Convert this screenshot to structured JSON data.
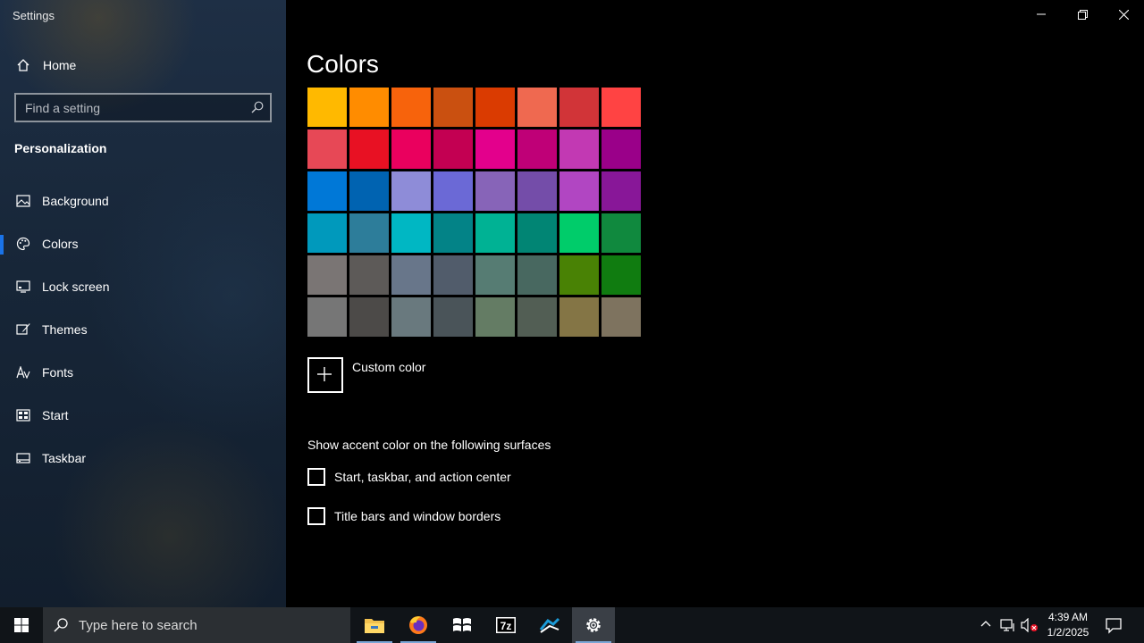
{
  "window": {
    "title": "Settings"
  },
  "sidebar": {
    "home_label": "Home",
    "search_placeholder": "Find a setting",
    "section_title": "Personalization",
    "items": [
      {
        "label": "Background",
        "icon": "picture-icon"
      },
      {
        "label": "Colors",
        "icon": "palette-icon",
        "active": true
      },
      {
        "label": "Lock screen",
        "icon": "lock-screen-icon"
      },
      {
        "label": "Themes",
        "icon": "brush-icon"
      },
      {
        "label": "Fonts",
        "icon": "font-icon"
      },
      {
        "label": "Start",
        "icon": "start-grid-icon"
      },
      {
        "label": "Taskbar",
        "icon": "taskbar-icon"
      }
    ]
  },
  "main": {
    "title": "Colors",
    "swatches": [
      "#FFB900",
      "#FF8C00",
      "#F7630C",
      "#CA5010",
      "#DA3B01",
      "#EF6950",
      "#D13438",
      "#FF4343",
      "#E74856",
      "#E81123",
      "#EA005E",
      "#C30052",
      "#E3008C",
      "#BF0077",
      "#C239B3",
      "#9A0089",
      "#0078D7",
      "#0063B1",
      "#8E8CD8",
      "#6B69D6",
      "#8764B8",
      "#744DA9",
      "#B146C2",
      "#881798",
      "#0099BC",
      "#2D7D9A",
      "#00B7C3",
      "#038387",
      "#00B294",
      "#018574",
      "#00CC6A",
      "#10893E",
      "#7A7574",
      "#5D5A58",
      "#68768A",
      "#515C6B",
      "#567C73",
      "#486860",
      "#498205",
      "#107C10",
      "#767676",
      "#4C4A48",
      "#69797E",
      "#4A5459",
      "#647C64",
      "#525E54",
      "#847545",
      "#7E735F"
    ],
    "custom_color_label": "Custom color",
    "surfaces_label": "Show accent color on the following surfaces",
    "checkboxes": [
      {
        "label": "Start, taskbar, and action center",
        "checked": false
      },
      {
        "label": "Title bars and window borders",
        "checked": false
      }
    ]
  },
  "taskbar": {
    "search_placeholder": "Type here to search",
    "apps": [
      "file-explorer-icon",
      "firefox-icon",
      "windows-7-icon",
      "7zip-icon",
      "steam-icon",
      "settings-gear-icon"
    ],
    "clock_time": "4:39 AM",
    "clock_date": "1/2/2025",
    "zip_glyph": "7z"
  },
  "colors": {
    "accent": "#1A73E8",
    "sidebar_bg": "#172638",
    "main_bg": "#000000",
    "taskbar_bg": "#101418"
  }
}
